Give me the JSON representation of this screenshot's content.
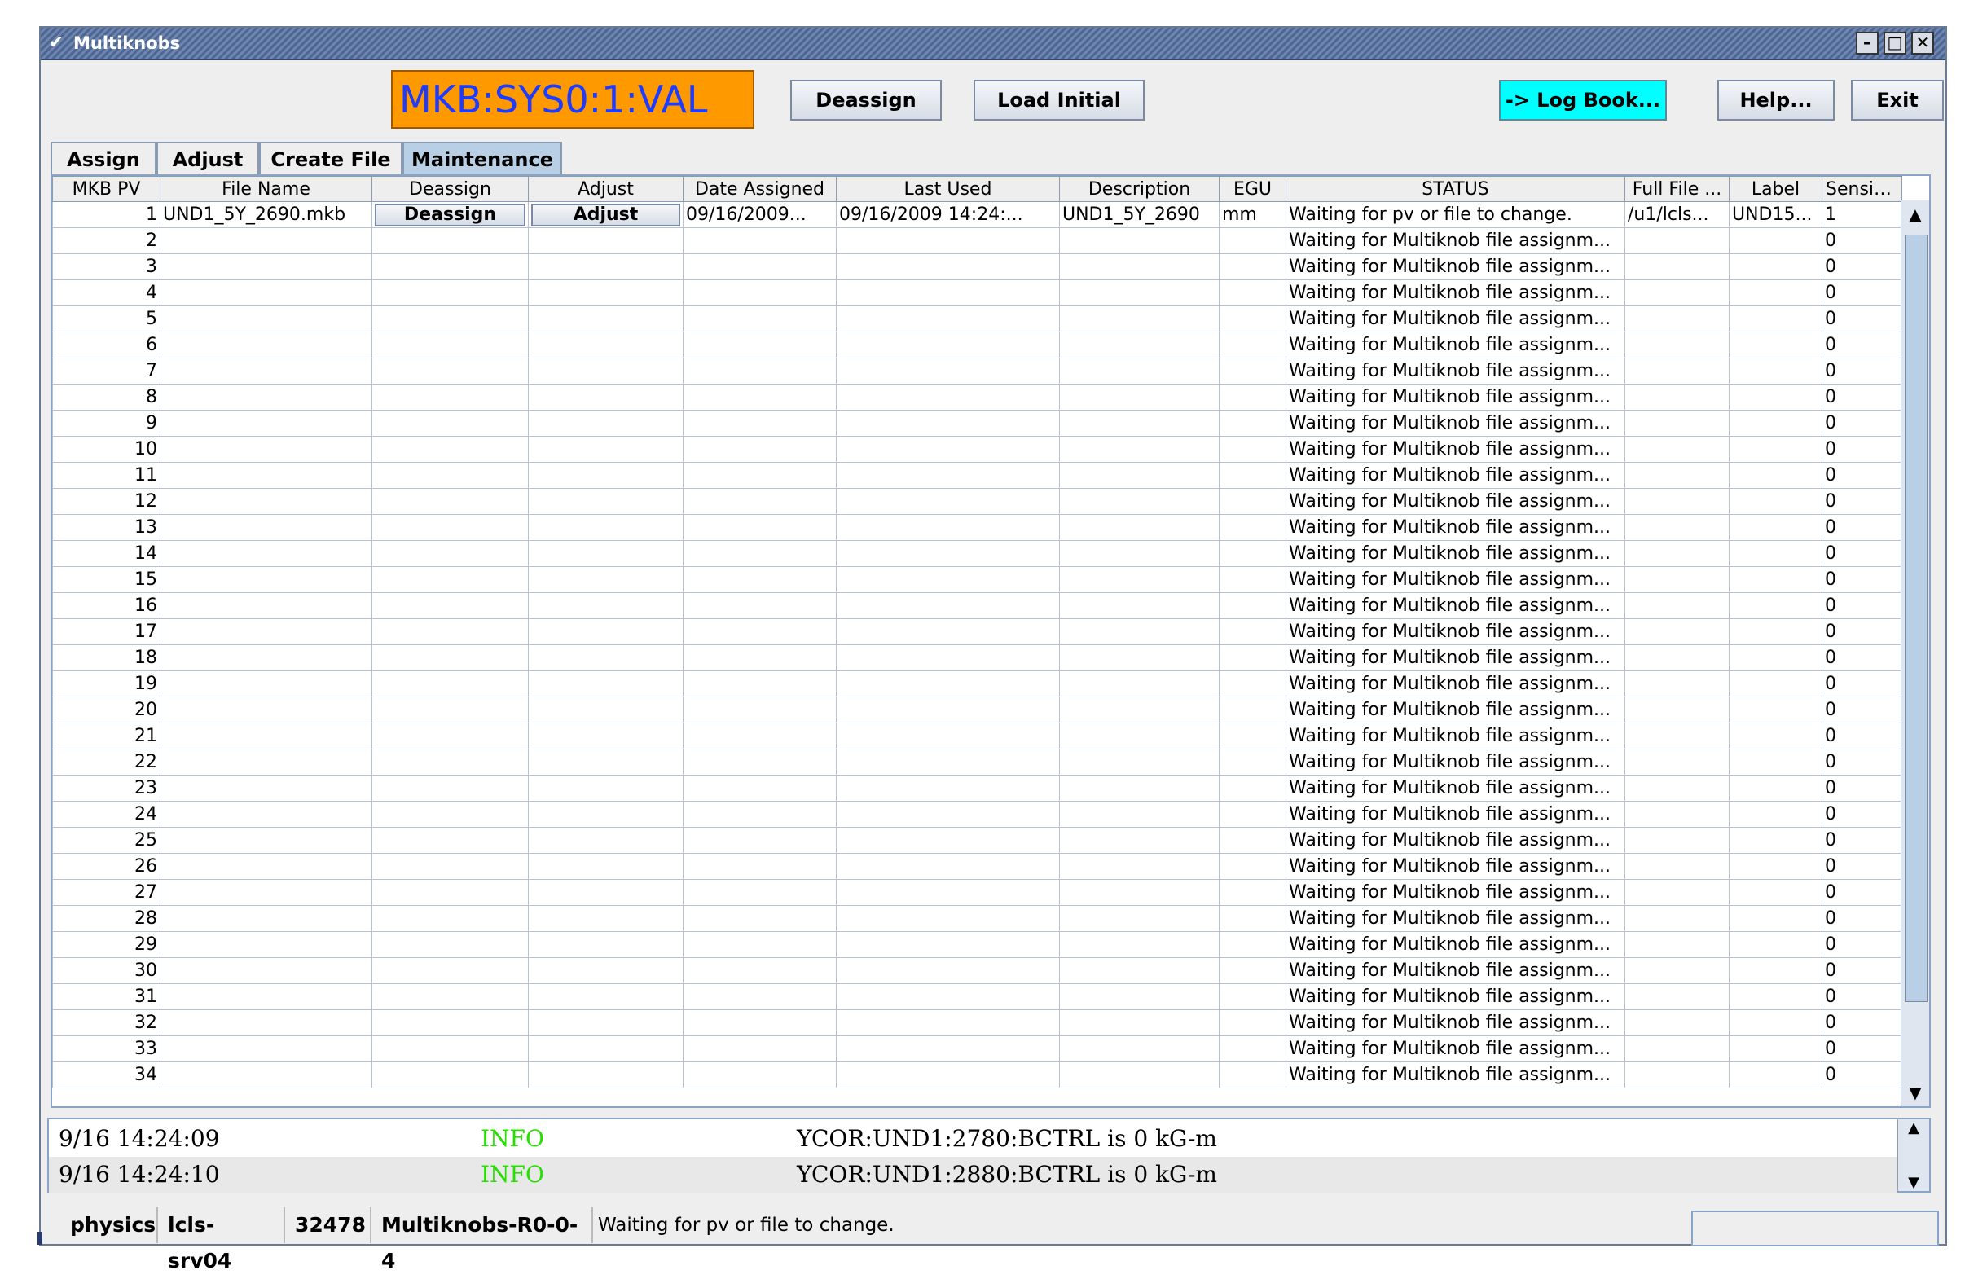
{
  "window": {
    "title": "Multiknobs"
  },
  "toolbar": {
    "pv_display": "MKB:SYS0:1:VAL",
    "deassign_label": "Deassign",
    "load_initial_label": "Load Initial",
    "logbook_label": "-> Log Book...",
    "help_label": "Help...",
    "exit_label": "Exit"
  },
  "tabs": [
    "Assign",
    "Adjust",
    "Create File",
    "Maintenance"
  ],
  "table": {
    "columns": [
      "MKB PV",
      "File Name",
      "Deassign",
      "Adjust",
      "Date Assigned",
      "Last Used",
      "Description",
      "EGU",
      "STATUS",
      "Full File ...",
      "Label",
      "Sensitivity"
    ],
    "first_row": {
      "pv": "1",
      "file_name": "UND1_5Y_2690.mkb",
      "deassign": "Deassign",
      "adjust": "Adjust",
      "date_assigned": "09/16/2009...",
      "last_used": "09/16/2009 14:24:...",
      "description": "UND1_5Y_2690",
      "egu": "mm",
      "status": "Waiting for pv or file to change.",
      "full_file": "/u1/lcls...",
      "label": "UND15...",
      "sensitivity": "1"
    },
    "empty_rows": [
      "2",
      "3",
      "4",
      "5",
      "6",
      "7",
      "8",
      "9",
      "10",
      "11",
      "12",
      "13",
      "14",
      "15",
      "16",
      "17",
      "18",
      "19",
      "20",
      "21",
      "22",
      "23",
      "24",
      "25",
      "26",
      "27",
      "28",
      "29",
      "30",
      "31",
      "32",
      "33",
      "34"
    ],
    "empty_status": "Waiting for Multiknob file assignm...",
    "empty_sensitivity": "0"
  },
  "log": [
    {
      "time": "9/16 14:24:09",
      "level": "INFO",
      "message": "YCOR:UND1:2780:BCTRL is 0 kG-m"
    },
    {
      "time": "9/16 14:24:10",
      "level": "INFO",
      "message": "YCOR:UND1:2880:BCTRL is 0 kG-m"
    }
  ],
  "statusbar": {
    "user": "physics",
    "host": "lcls-srv04",
    "pid": "32478",
    "app": "Multiknobs-R0-0-4",
    "message": "Waiting for pv or file to change."
  },
  "colors": {
    "pv_bg": "#ff9900",
    "pv_text": "#1d3cff",
    "logbook_bg": "#00ffff",
    "info": "#27e000",
    "active_tab": "#b8cfe5"
  }
}
